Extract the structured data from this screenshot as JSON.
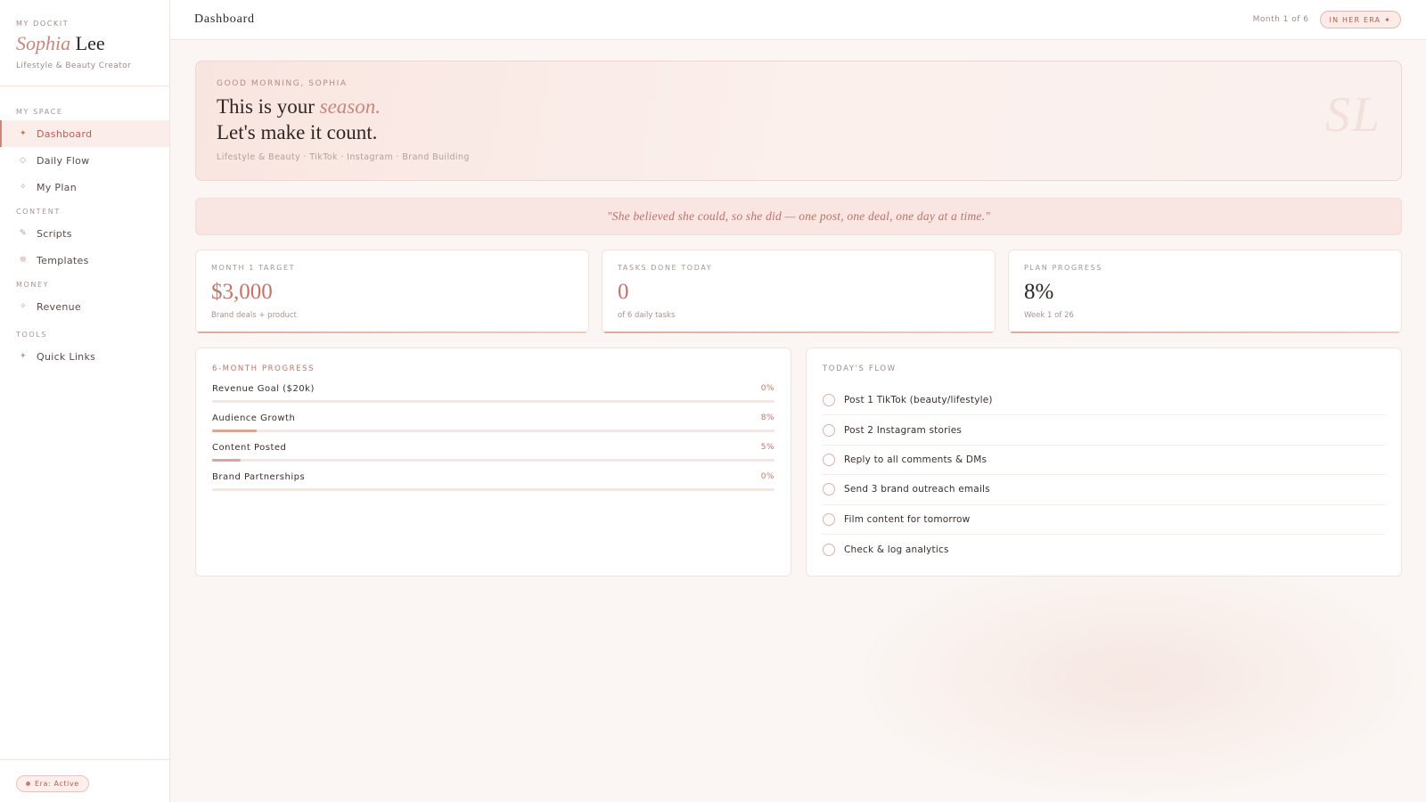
{
  "sidebar": {
    "eyebrow": "MY DOCKIT",
    "name_first": "Sophia",
    "name_last": " Lee",
    "subtitle": "Lifestyle & Beauty Creator",
    "sections": {
      "my_space": "MY SPACE",
      "content": "CONTENT",
      "money": "MONEY",
      "tools": "TOOLS"
    },
    "items": [
      {
        "label": "Dashboard",
        "icon": "sparkle-icon",
        "glyph": "✦"
      },
      {
        "label": "Daily Flow",
        "icon": "diamond-icon",
        "glyph": "◇"
      },
      {
        "label": "My Plan",
        "icon": "star-icon",
        "glyph": "✧"
      },
      {
        "label": "Scripts",
        "icon": "pencil-icon",
        "glyph": "✎"
      },
      {
        "label": "Templates",
        "icon": "asterisk-icon",
        "glyph": "❊"
      },
      {
        "label": "Revenue",
        "icon": "coin-icon",
        "glyph": "✧"
      },
      {
        "label": "Quick Links",
        "icon": "link-icon",
        "glyph": "✦"
      }
    ],
    "footer_badge": "Era: Active"
  },
  "topbar": {
    "title": "Dashboard",
    "month": "Month 1 of 6",
    "era_badge": "IN HER ERA ✦"
  },
  "hero": {
    "greeting": "GOOD MORNING, SOPHIA",
    "line1_pre": "This is your ",
    "line1_em": "season.",
    "line2": "Let's make it count.",
    "tags": "Lifestyle & Beauty · TikTok · Instagram · Brand Building",
    "monogram": "SL"
  },
  "quote": "\"She believed she could, so she did — one post, one deal, one day at a time.\"",
  "stats": [
    {
      "label": "MONTH 1 TARGET",
      "value": "$3,000",
      "sub": "Brand deals + product"
    },
    {
      "label": "TASKS DONE TODAY",
      "value": "0",
      "sub": "of 6 daily tasks"
    },
    {
      "label": "PLAN PROGRESS",
      "value": "8%",
      "sub": "Week 1 of 26"
    }
  ],
  "progress": {
    "title": "6-MONTH PROGRESS",
    "items": [
      {
        "label": "Revenue Goal ($20k)",
        "pct_label": "0%",
        "value": 0
      },
      {
        "label": "Audience Growth",
        "pct_label": "8%",
        "value": 8
      },
      {
        "label": "Content Posted",
        "pct_label": "5%",
        "value": 5
      },
      {
        "label": "Brand Partnerships",
        "pct_label": "0%",
        "value": 0
      }
    ]
  },
  "flow": {
    "title": "TODAY'S FLOW",
    "items": [
      "Post 1 TikTok (beauty/lifestyle)",
      "Post 2 Instagram stories",
      "Reply to all comments & DMs",
      "Send 3 brand outreach emails",
      "Film content for tomorrow",
      "Check & log analytics"
    ]
  },
  "colors": {
    "accent": "#c9867d",
    "accent_dark": "#b85c54",
    "background": "#fbf6f3"
  }
}
